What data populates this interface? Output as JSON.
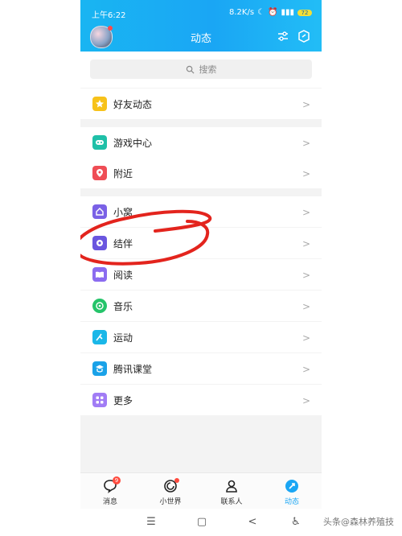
{
  "status": {
    "time": "上午6:22",
    "speed": "8.2K/s",
    "battery": "72"
  },
  "header": {
    "title": "动态"
  },
  "search": {
    "placeholder": "搜索"
  },
  "sections": [
    {
      "items": [
        {
          "label": "好友动态",
          "icon": "star-icon",
          "color": "#f7c21a"
        }
      ]
    },
    {
      "items": [
        {
          "label": "游戏中心",
          "icon": "gamepad-icon",
          "color": "#1fc0a8"
        },
        {
          "label": "附近",
          "icon": "location-pin-icon",
          "color": "#ef4d55"
        }
      ]
    },
    {
      "items": [
        {
          "label": "小窝",
          "icon": "home-icon",
          "color": "#7a61e6"
        },
        {
          "label": "结伴",
          "icon": "companion-icon",
          "color": "#6a56df"
        },
        {
          "label": "阅读",
          "icon": "book-icon",
          "color": "#8b6cf0"
        },
        {
          "label": "音乐",
          "icon": "music-icon",
          "color": "#25c46a"
        },
        {
          "label": "运动",
          "icon": "sport-icon",
          "color": "#1ab7e8"
        },
        {
          "label": "腾讯课堂",
          "icon": "classroom-icon",
          "color": "#1aa2e8"
        },
        {
          "label": "更多",
          "icon": "grid-icon",
          "color": "#a17cf5"
        }
      ]
    }
  ],
  "tabs": [
    {
      "label": "消息",
      "icon": "message-icon",
      "badge": "9"
    },
    {
      "label": "小世界",
      "icon": "small-world-icon",
      "dot": true
    },
    {
      "label": "联系人",
      "icon": "contacts-icon"
    },
    {
      "label": "动态",
      "icon": "moments-icon",
      "active": true
    }
  ],
  "watermark": "头条@森林养殖技"
}
